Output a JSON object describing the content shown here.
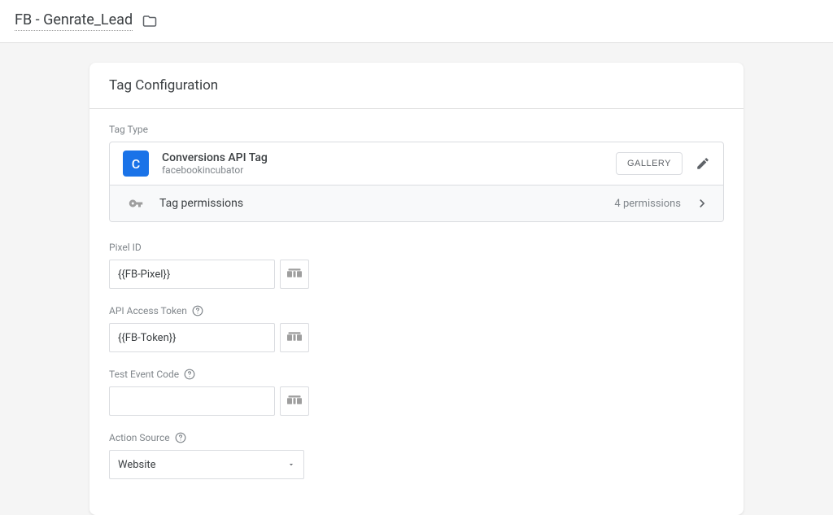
{
  "header": {
    "title": "FB - Genrate_Lead"
  },
  "card": {
    "title": "Tag Configuration",
    "tagTypeLabel": "Tag Type",
    "tag": {
      "iconLetter": "C",
      "name": "Conversions API Tag",
      "author": "facebookincubator",
      "galleryBtn": "GALLERY"
    },
    "permissions": {
      "label": "Tag permissions",
      "count": "4 permissions"
    },
    "fields": {
      "pixelId": {
        "label": "Pixel ID",
        "value": "{{FB-Pixel}}"
      },
      "apiToken": {
        "label": "API Access Token",
        "value": "{{FB-Token}}"
      },
      "testEvent": {
        "label": "Test Event Code",
        "value": ""
      },
      "actionSource": {
        "label": "Action Source",
        "value": "Website"
      }
    }
  }
}
